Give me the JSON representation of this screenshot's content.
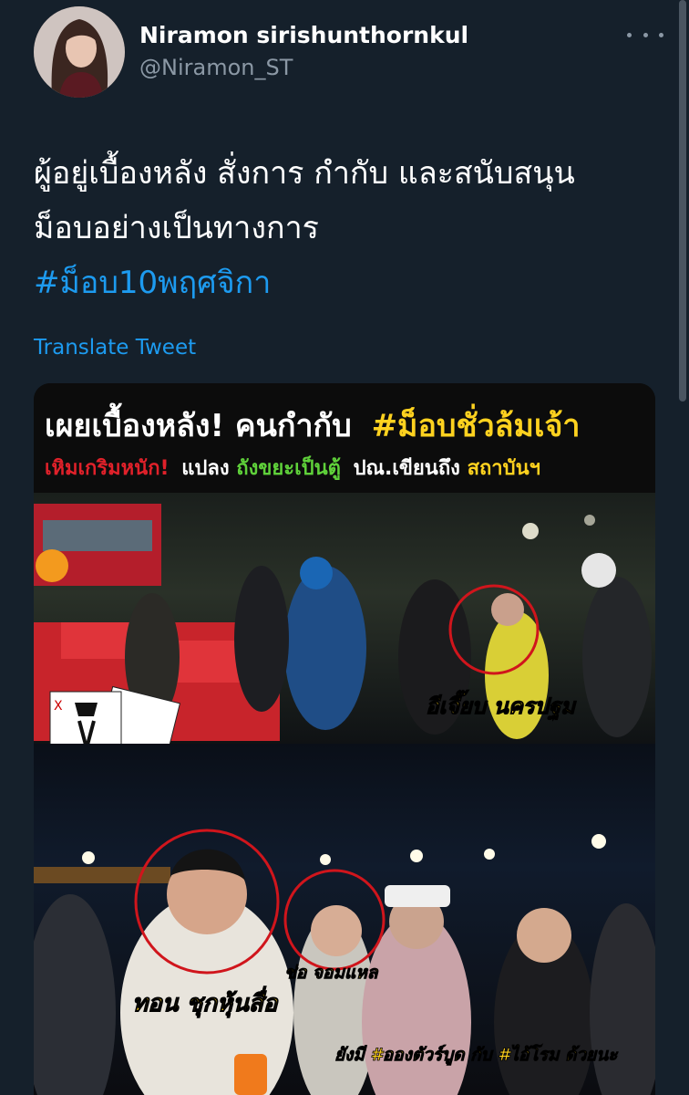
{
  "author": {
    "display_name": "Niramon sirishunthornkul",
    "handle": "@Niramon_ST"
  },
  "tweet": {
    "line1": "ผู้อยู่เบื้องหลัง สั่งการ กำกับ และสนับสนุน",
    "line2": "ม็อบอย่างเป็นทางการ",
    "hashtag": "#ม็อบ10พฤศจิกา",
    "translate_label": "Translate Tweet"
  },
  "media": {
    "headline_part1": "เผยเบื้องหลัง! คนกำกับ",
    "headline_part2": "#ม็อบชั่วล้มเจ้า",
    "sub_red": "เหิมเกริมหนัก!",
    "sub_white1": "แปลง",
    "sub_green": "ถังขยะเป็นตู้",
    "sub_white2": "ปณ.เขียนถึง",
    "sub_yellow": "สถาบันฯ",
    "caption_top": "อีเจี๊ยบ นครปฐม",
    "caption_bottom_left": "ทอน ชุกหุ้นสื่อ",
    "caption_bottom_mid": "ช่อ จอมแหล",
    "caption_bottom_right": "ยังมี #อองตัวร์บูด กับ #ไอ้โรม ด้วยนะ"
  },
  "colors": {
    "background": "#15202b",
    "link": "#1d9bf0",
    "muted": "#8b98a5",
    "circle_red": "#d0151c",
    "caption_yellow": "#ffd21f"
  }
}
